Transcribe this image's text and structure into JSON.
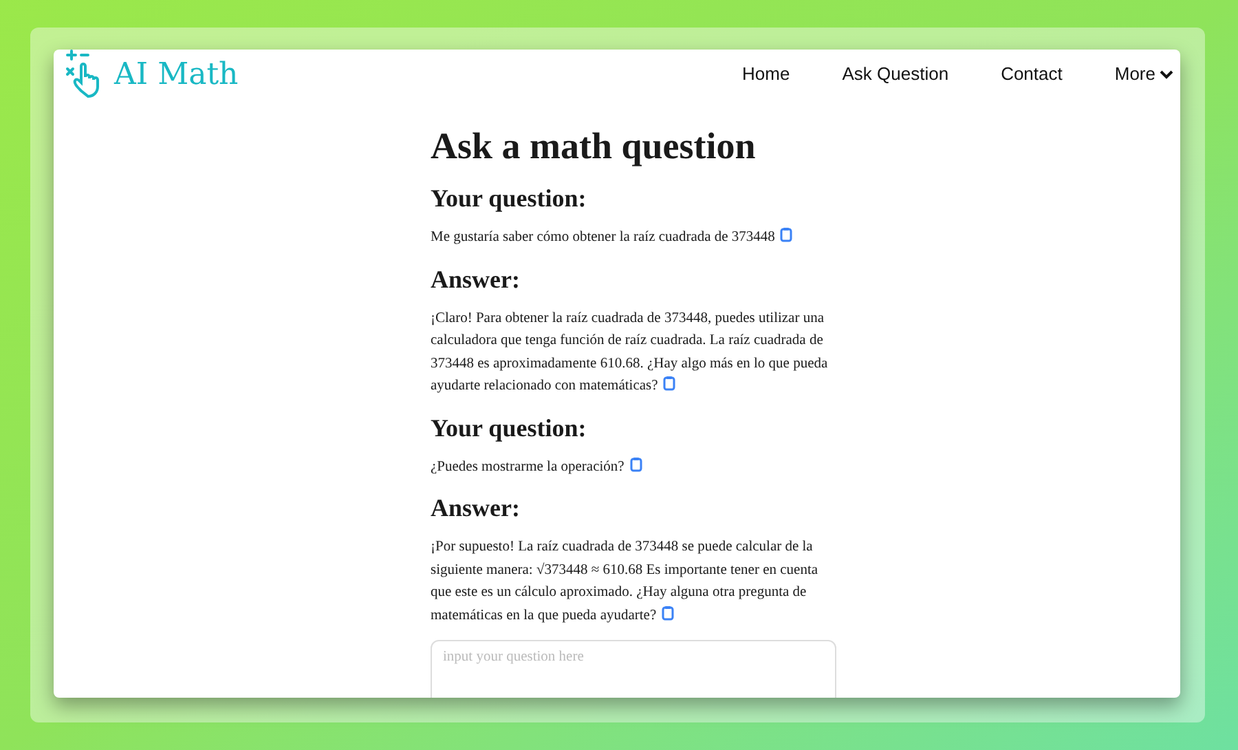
{
  "logo": {
    "text": "AI Math"
  },
  "nav": [
    {
      "label": "Home",
      "kind": "link"
    },
    {
      "label": "Ask Question",
      "kind": "link"
    },
    {
      "label": "Contact",
      "kind": "link"
    },
    {
      "label": "More",
      "kind": "dropdown"
    }
  ],
  "page_title": "Ask a math question",
  "messages": [
    {
      "heading": "Your question:",
      "text": "Me gustaría saber cómo obtener la raíz cuadrada de 373448"
    },
    {
      "heading": "Answer:",
      "text": "¡Claro! Para obtener la raíz cuadrada de 373448, puedes utilizar una calculadora que tenga función de raíz cuadrada. La raíz cuadrada de 373448 es aproximadamente 610.68. ¿Hay algo más en lo que pueda ayudarte relacionado con matemáticas?"
    },
    {
      "heading": "Your question:",
      "text": "¿Puedes mostrarme la operación?"
    },
    {
      "heading": "Answer:",
      "text": "¡Por supuesto! La raíz cuadrada de 373448 se puede calcular de la siguiente manera: √373448 ≈ 610.68 Es importante tener en cuenta que este es un cálculo aproximado. ¿Hay alguna otra pregunta de matemáticas en la que pueda ayudarte?"
    }
  ],
  "question_input": {
    "placeholder": "input your question here"
  }
}
